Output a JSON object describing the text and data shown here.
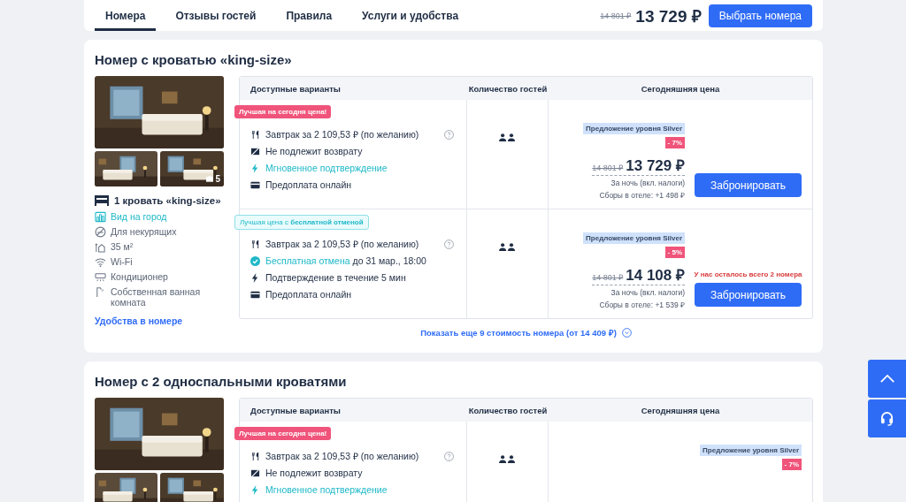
{
  "nav": {
    "tabs": [
      {
        "label": "Номера",
        "selected": true
      },
      {
        "label": "Отзывы гостей",
        "selected": false
      },
      {
        "label": "Правила",
        "selected": false
      },
      {
        "label": "Услуги и удобства",
        "selected": false
      }
    ],
    "old_price": "14 801 ₽",
    "price": "13 729 ₽",
    "button": "Выбрать номера"
  },
  "rooms": [
    {
      "title": "Номер с кроватью «king-size»",
      "photo_count": "5",
      "bed": "1 кровать «king-size»",
      "amenities": [
        {
          "kind": "view",
          "text": "Вид на город",
          "highlight": true
        },
        {
          "kind": "nosmoke",
          "text": "Для некурящих",
          "highlight": false
        },
        {
          "kind": "area",
          "text": "35 м²",
          "highlight": false
        },
        {
          "kind": "wifi",
          "text": "Wi-Fi",
          "highlight": false
        },
        {
          "kind": "ac",
          "text": "Кондиционер",
          "highlight": false
        },
        {
          "kind": "bath",
          "text": "Собственная ванная комната",
          "highlight": false
        }
      ],
      "amenities_link": "Удобства в номере",
      "columns": [
        "Доступные варианты",
        "Количество гостей",
        "Сегодняшняя цена"
      ],
      "offers": [
        {
          "tag": {
            "kind": "best",
            "text": "Лучшая на сегодня цена!"
          },
          "features": [
            {
              "kind": "breakfast",
              "text": "Завтрак за 2 109,53 ₽ (по желанию)",
              "help": true
            },
            {
              "kind": "nonrefund",
              "text": "Не подлежит возврату",
              "help": false
            },
            {
              "kind": "instant",
              "accent": "Мгновенное подтверждение",
              "help": false
            },
            {
              "kind": "card",
              "text": "Предоплата онлайн",
              "help": false
            }
          ],
          "silver": "Предложение уровня Silver",
          "discount": "- 7%",
          "old_price": "14 801 ₽",
          "price": "13 729 ₽",
          "per_night": "За ночь (вкл. налоги)",
          "fees": "Сборы в отеле: +1 498 ₽",
          "button": "Забронировать"
        },
        {
          "tag": {
            "kind": "free_cancel",
            "text": "Лучшая цена с **бесплатной отменой**"
          },
          "features": [
            {
              "kind": "breakfast",
              "text": "Завтрак за 2 109,53 ₽ (по желанию)",
              "help": true
            },
            {
              "kind": "cancel",
              "accent": "Бесплатная отмена",
              "text": "до 31 мар., 18:00",
              "help": false
            },
            {
              "kind": "bolt",
              "text": "Подтверждение в течение 5 мин",
              "help": false
            },
            {
              "kind": "card",
              "text": "Предоплата онлайн",
              "help": false
            }
          ],
          "silver": "Предложение уровня Silver",
          "discount": "- 5%",
          "old_price": "14 801 ₽",
          "price": "14 108 ₽",
          "per_night": "За ночь (вкл. налоги)",
          "fees": "Сборы в отеле: +1 539 ₽",
          "scarcity": "У нас осталось всего 2 номера",
          "button": "Забронировать"
        }
      ],
      "show_more": "Показать еще 9 стоимость номера (от 14 409 ₽)"
    },
    {
      "title": "Номер с 2 односпальными кроватями",
      "columns": [
        "Доступные варианты",
        "Количество гостей",
        "Сегодняшняя цена"
      ],
      "offers": [
        {
          "tag": {
            "kind": "best",
            "text": "Лучшая на сегодня цена!"
          },
          "features": [
            {
              "kind": "breakfast",
              "text": "Завтрак за 2 109,53 ₽ (по желанию)",
              "help": true
            },
            {
              "kind": "nonrefund",
              "text": "Не подлежит возврату",
              "help": false
            },
            {
              "kind": "instant",
              "accent": "Мгновенное подтверждение",
              "help": false
            }
          ],
          "silver": "Предложение уровня Silver",
          "discount": "- 7%"
        }
      ]
    }
  ]
}
